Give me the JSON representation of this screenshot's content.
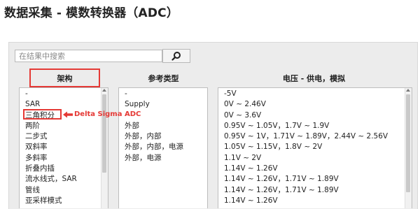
{
  "page_title": "数据采集 - 模数转换器（ADC）",
  "search": {
    "placeholder": "在结果中搜索",
    "button_icon": "search-icon"
  },
  "columns": [
    {
      "header": "架构",
      "items": [
        "-",
        "SAR",
        "三角积分",
        "两阶",
        "二步式",
        "双斜率",
        "多斜率",
        "折叠内插",
        "流水线式，SAR",
        "管线",
        "亚采样模式"
      ]
    },
    {
      "header": "参考类型",
      "items": [
        "-",
        "Supply",
        "",
        "外部",
        "外部，内部",
        "外部，内部，电源",
        "外部，电源"
      ]
    },
    {
      "header": "电压 - 供电，模拟",
      "items": [
        "-5V",
        "0V ~ 2.46V",
        "0V ~ 3.6V",
        "0.95V ~ 1.05V，1.7V ~ 1.9V",
        "0.95V ~ 1V，1.71V ~ 1.89V，2.44V ~ 2.56V",
        "1.05V ~ 1.15V，1.8V ~ 2V",
        "1.1V ~ 2V",
        "1.14V ~ 1.26V",
        "1.14V ~ 1.26V，1.71V ~ 1.89V",
        "1.14V ~ 1.26V，1.71V ~ 1.89V",
        "1.14V ~ 1.26V"
      ]
    }
  ],
  "annotation": {
    "label": "Delta Sigma ADC",
    "highlighted_item": "三角积分",
    "color": "#e53935"
  },
  "colors": {
    "panel_bg": "#ececec",
    "highlight": "#e53935"
  }
}
